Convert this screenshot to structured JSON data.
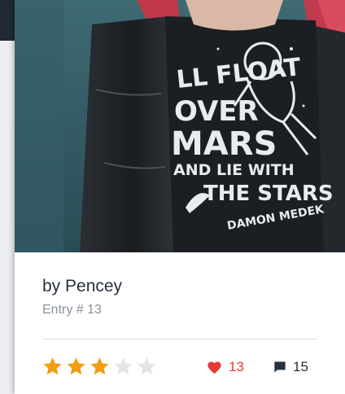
{
  "card": {
    "author": "by Pencey",
    "entry": "Entry # 13",
    "shirt_lines": [
      "LL FLOAT",
      "OVER",
      "MARS",
      "AND LIE WITH",
      "THE STARS",
      "DAMON MEDEK"
    ],
    "rating": {
      "value": 3,
      "max": 5,
      "filled_color": "#f39c12",
      "empty_color": "#e3e5e8"
    },
    "likes": "13",
    "comments": "15",
    "colors": {
      "like": "#e53935",
      "comment": "#26313d"
    }
  },
  "icons": {
    "like": "heart-icon",
    "comment": "comment-icon",
    "star": "star-icon"
  }
}
